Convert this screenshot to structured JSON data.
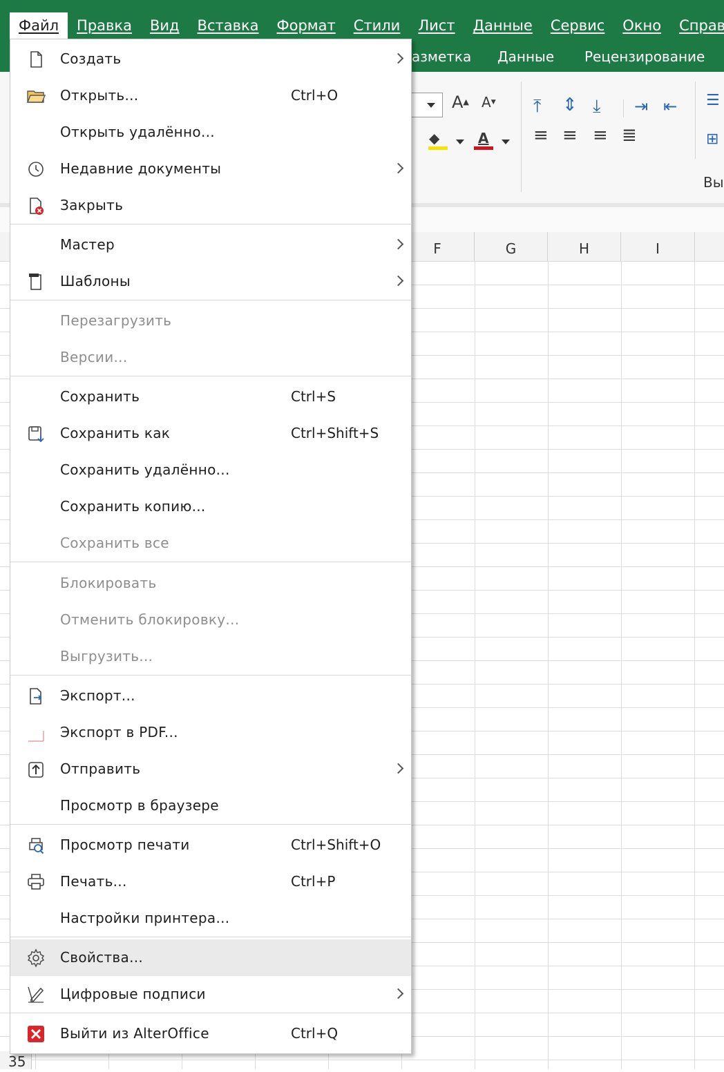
{
  "menubar": {
    "items": [
      {
        "label": "Файл",
        "active": true
      },
      {
        "label": "Правка"
      },
      {
        "label": "Вид"
      },
      {
        "label": "Вставка"
      },
      {
        "label": "Формат"
      },
      {
        "label": "Стили"
      },
      {
        "label": "Лист"
      },
      {
        "label": "Данные"
      },
      {
        "label": "Сервис"
      },
      {
        "label": "Окно"
      },
      {
        "label": "Справка"
      }
    ]
  },
  "ribbon": {
    "tabs": [
      "азметка",
      "Данные",
      "Рецензирование"
    ],
    "group_label": "Вы",
    "font_color_glyph": "A",
    "highlight_color": "#f5e400",
    "font_color": "#d0141e"
  },
  "columns": [
    "F",
    "G",
    "H",
    "I"
  ],
  "row_number": "35",
  "colors": {
    "brand": "#1e7a45",
    "accent_blue": "#2a66b8",
    "close_red": "#d9262b"
  },
  "menu": {
    "items": [
      {
        "label": "Создать",
        "icon": "new-document-icon",
        "submenu": true
      },
      {
        "label": "Открыть...",
        "shortcut": "Ctrl+O",
        "icon": "open-folder-icon"
      },
      {
        "label": "Открыть удалённо..."
      },
      {
        "label": "Недавние документы",
        "icon": "recent-documents-icon",
        "submenu": true
      },
      {
        "label": "Закрыть",
        "icon": "close-document-icon"
      },
      {
        "label": "Мастер",
        "submenu": true
      },
      {
        "label": "Шаблоны",
        "icon": "templates-icon",
        "submenu": true
      },
      {
        "label": "Перезагрузить",
        "disabled": true
      },
      {
        "label": "Версии...",
        "disabled": true
      },
      {
        "label": "Сохранить",
        "shortcut": "Ctrl+S"
      },
      {
        "label": "Сохранить как",
        "shortcut": "Ctrl+Shift+S",
        "icon": "save-as-icon"
      },
      {
        "label": "Сохранить удалённо..."
      },
      {
        "label": "Сохранить копию..."
      },
      {
        "label": "Сохранить все",
        "disabled": true
      },
      {
        "label": "Блокировать",
        "disabled": true
      },
      {
        "label": "Отменить блокировку...",
        "disabled": true
      },
      {
        "label": "Выгрузить...",
        "disabled": true
      },
      {
        "label": "Экспорт...",
        "icon": "export-icon"
      },
      {
        "label": "Экспорт в PDF...",
        "icon": "export-pdf-icon"
      },
      {
        "label": "Отправить",
        "icon": "send-icon",
        "submenu": true
      },
      {
        "label": "Просмотр в браузере"
      },
      {
        "label": "Просмотр печати",
        "shortcut": "Ctrl+Shift+O",
        "icon": "print-preview-icon"
      },
      {
        "label": "Печать...",
        "shortcut": "Ctrl+P",
        "icon": "printer-icon"
      },
      {
        "label": "Настройки принтера..."
      },
      {
        "label": "Свойства...",
        "icon": "gear-icon",
        "hover": true
      },
      {
        "label": "Цифровые подписи",
        "icon": "signature-icon",
        "submenu": true
      },
      {
        "label": "Выйти из AlterOffice",
        "shortcut": "Ctrl+Q",
        "icon": "exit-icon"
      }
    ]
  }
}
